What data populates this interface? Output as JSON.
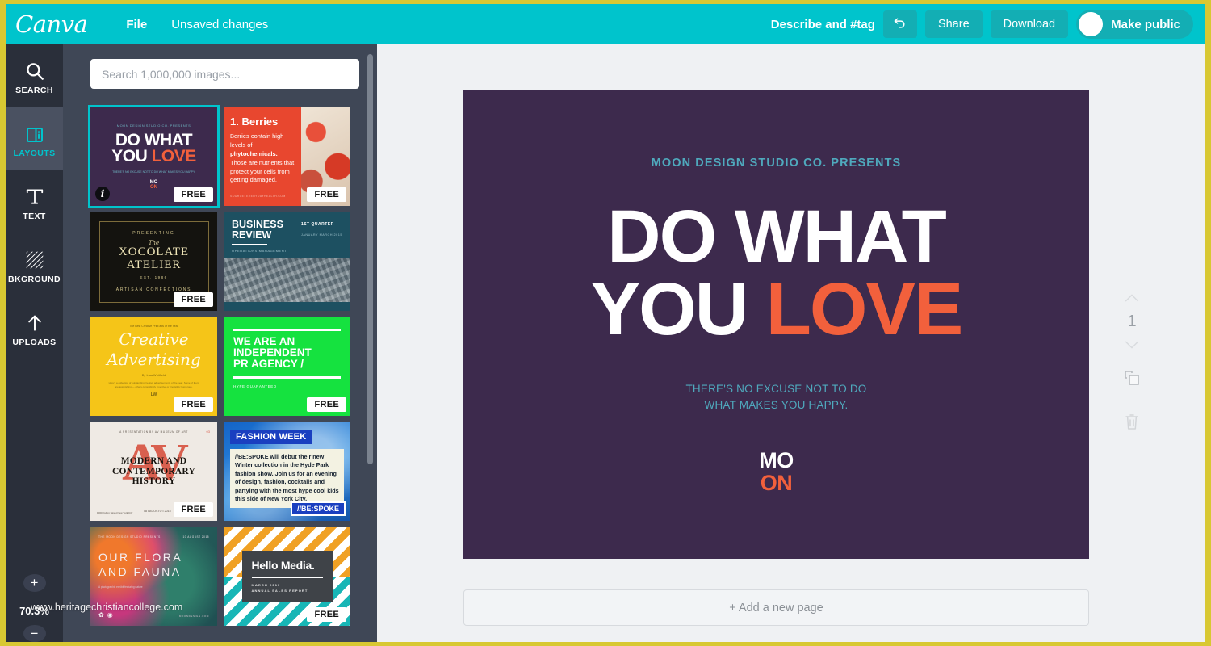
{
  "topbar": {
    "logo": "Canva",
    "file_label": "File",
    "save_status": "Unsaved changes",
    "describe_tag": "Describe and #tag",
    "undo_label": "↰",
    "share_label": "Share",
    "download_label": "Download",
    "make_public_label": "Make public",
    "accent_color": "#00c4cc",
    "button_color": "#13aeb4"
  },
  "rail": {
    "items": [
      {
        "label": "SEARCH",
        "icon": "search-icon",
        "active": false
      },
      {
        "label": "LAYOUTS",
        "icon": "layouts-icon",
        "active": true
      },
      {
        "label": "TEXT",
        "icon": "text-icon",
        "active": false
      },
      {
        "label": "BKGROUND",
        "icon": "background-icon",
        "active": false
      },
      {
        "label": "UPLOADS",
        "icon": "upload-icon",
        "active": false
      }
    ],
    "zoom_in": "+",
    "zoom_value": "70.3%",
    "zoom_out": "−"
  },
  "panel": {
    "search_placeholder": "Search 1,000,000 images...",
    "search_value": "",
    "free_badge": "FREE",
    "info_badge": "i",
    "templates": [
      {
        "id": "do-what-you-love",
        "selected": true,
        "free": true,
        "pre": "MOON DESIGN STUDIO CO. PRESENTS",
        "line1": "DO WHAT",
        "line2a": "YOU ",
        "line2b": "LOVE",
        "sub": "THERE'S NO EXCUSE NOT TO DO WHAT MAKES YOU HAPPY.",
        "logo_a": "MO",
        "logo_b": "ON"
      },
      {
        "id": "berries",
        "free": true,
        "title": "1. Berries",
        "body_1": "Berries contain high levels of ",
        "body_bold": "phytochemicals.",
        "body_2": " Those are nutrients that protect your cells from getting damaged.",
        "source": "SOURCE: EVERYDAYHEALTH.COM"
      },
      {
        "id": "xocolate-atelier",
        "free": true,
        "presenting": "PRESENTING",
        "the": "The",
        "name1": "XOCOLATE",
        "name2": "ATELIER",
        "est": "EST. 1986",
        "footer": "ARTISAN CONFECTIONS"
      },
      {
        "id": "business-review",
        "free": false,
        "line1": "BUSINESS",
        "line2": "REVIEW",
        "sub": "OPERATIONS MANAGEMENT",
        "quarter": "1ST QUARTER",
        "dates": "JANUARY MARCH 2015"
      },
      {
        "id": "creative-advertising",
        "free": true,
        "pre": "The Best Creative Print ads of the Year",
        "title1": "Creative",
        "title2": "Advertising",
        "by": "By Lisa Whitfield",
        "body": "Here's a collection of outstanding creative advertisements of the year. Some of them are astonishing — others compellingly inventive or irresistibly humorous.",
        "logo": "LW"
      },
      {
        "id": "pr-agency",
        "free": true,
        "line1": "WE ARE AN",
        "line2": "INDEPENDENT",
        "line3": "PR AGENCY /",
        "sub": "HYPE GUARANTEED"
      },
      {
        "id": "modern-contemporary-history",
        "free": true,
        "pre": "A PRESENTATION BY AV MUSEUM OF ART",
        "mark": "AV",
        "num": "03",
        "line1": "MODERN AND",
        "line2": "CONTEMPORARY",
        "line3": "HISTORY",
        "footer1": "1000 Fulton Street New York City",
        "footer2": "08 • AGOSTO • 2015"
      },
      {
        "id": "fashion-week",
        "free": false,
        "tag": "FASHION WEEK",
        "body": "//BE:SPOKE will debut their new Winter collection in the Hyde Park fashion show. Join us for an evening of design, fashion, cocktails and partying with the most hype cool kids this side of New York City.",
        "brand": "//BE:SPOKE"
      },
      {
        "id": "our-flora-and-fauna",
        "free": false,
        "pre": "THE MOON DESIGN STUDIO PRESENTS",
        "date": "10 AUGUST 2015",
        "line1": "OUR FLORA",
        "line2": "AND FAUNA",
        "sub": "A photographic exhibit featuring nature",
        "footer": "MOONDESIGN.COM"
      },
      {
        "id": "hello-media",
        "free": true,
        "title": "Hello Media.",
        "sub1": "MARCH 2011",
        "sub2": "ANNUAL SALES REPORT"
      }
    ]
  },
  "canvas": {
    "design": {
      "background": "#3d2a4d",
      "pre_header": "MOON DESIGN STUDIO CO. PRESENTS",
      "headline_line1": "DO WHAT",
      "headline_line2_white": "YOU ",
      "headline_line2_accent": "LOVE",
      "accent_color": "#f2603c",
      "teal_text_color": "#4fa9bd",
      "sub_line1": "THERE'S NO EXCUSE NOT TO DO",
      "sub_line2": "WHAT MAKES YOU HAPPY.",
      "logo_top": "MO",
      "logo_bottom": "ON"
    },
    "add_page_label": "+ Add a new page",
    "page_tools": {
      "move_up": "move-up-arrow",
      "page_number": "1",
      "move_down": "move-down-arrow",
      "duplicate": "duplicate-icon",
      "delete": "trash-icon"
    }
  },
  "watermark": "www.heritagechristiancollege.com"
}
